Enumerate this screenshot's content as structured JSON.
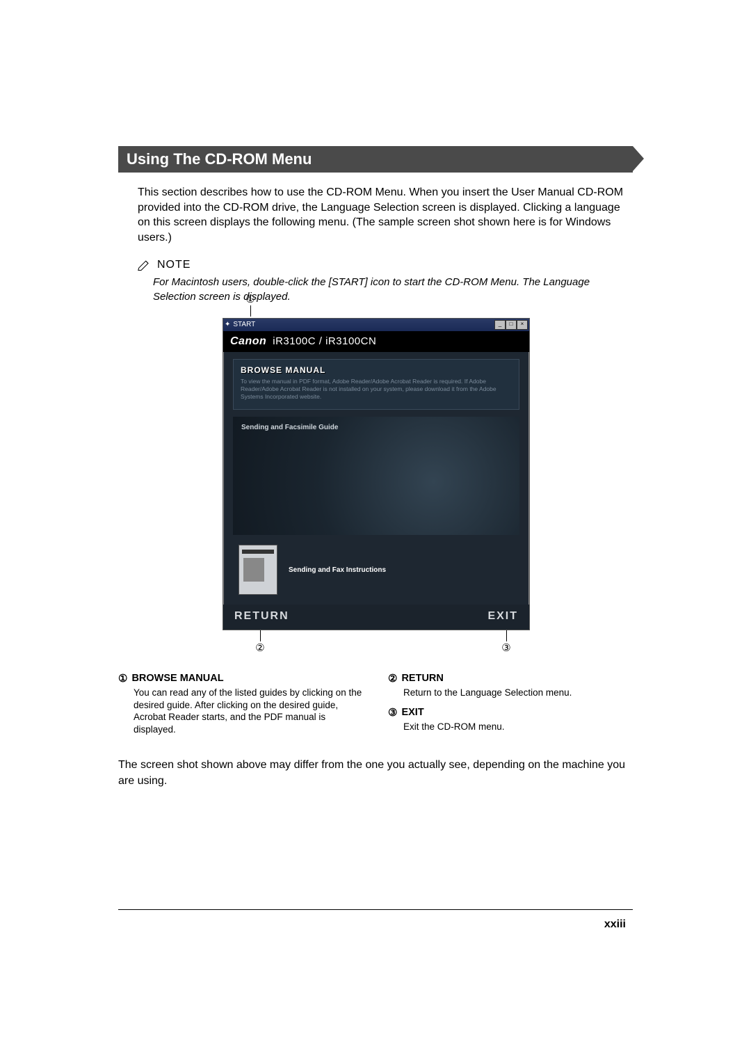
{
  "heading": "Using The CD-ROM Menu",
  "intro": "This section describes how to use the CD-ROM Menu. When you insert the User Manual CD-ROM provided into the CD-ROM drive, the Language Selection screen is displayed. Clicking a language on this screen displays the following menu. (The sample screen shot shown here is for Windows users.)",
  "note_label": "NOTE",
  "note_text": "For Macintosh users, double-click the [START] icon to start the CD-ROM Menu. The Language Selection screen is displayed.",
  "callouts": {
    "c1": "①",
    "c2": "②",
    "c3": "③"
  },
  "window": {
    "title_left_icon": "✦",
    "title_left": "START",
    "brand": "Canon",
    "model": "iR3100C / iR3100CN",
    "browse_title": "BROWSE MANUAL",
    "browse_desc": "To view the manual in PDF format, Adobe Reader/Adobe Acrobat Reader is required. If Adobe Reader/Adobe Acrobat Reader is not installed on your system, please download it from the Adobe Systems Incorporated website.",
    "guide_item": "Sending and Facsimile Guide",
    "thumb_label": "Sending and Fax Instructions",
    "return_label": "RETURN",
    "exit_label": "EXIT",
    "win_min": "_",
    "win_max": "□",
    "win_close": "×"
  },
  "legend": {
    "l1_num": "①",
    "l1_title": "BROWSE MANUAL",
    "l1_text": "You can read any of the listed guides by clicking on the desired guide. After clicking on the desired guide, Acrobat Reader starts, and the PDF manual is displayed.",
    "l2_num": "②",
    "l2_title": "RETURN",
    "l2_text": "Return to the Language Selection menu.",
    "l3_num": "③",
    "l3_title": "EXIT",
    "l3_text": "Exit the CD-ROM menu."
  },
  "closing": "The screen shot shown above may differ from the one you actually see, depending on the machine you are using.",
  "page_number": "xxiii"
}
